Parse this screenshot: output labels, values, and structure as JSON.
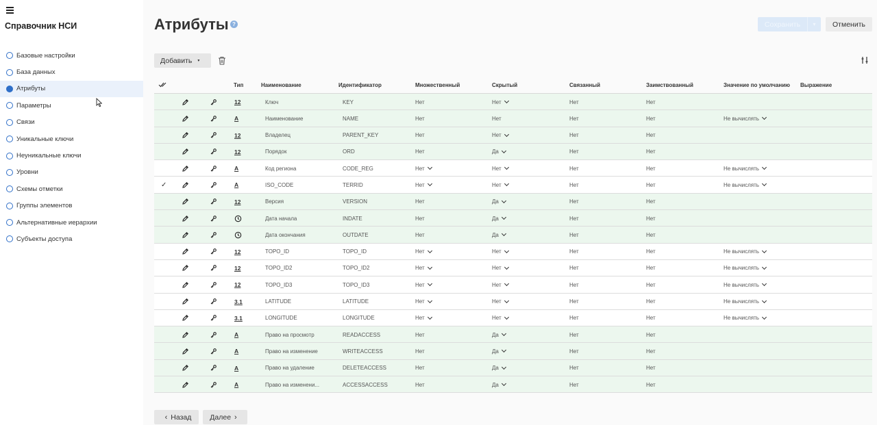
{
  "sidebar": {
    "title": "Справочник НСИ",
    "items": [
      {
        "label": "Базовые настройки",
        "active": false
      },
      {
        "label": "База данных",
        "active": false
      },
      {
        "label": "Атрибуты",
        "active": true
      },
      {
        "label": "Параметры",
        "active": false
      },
      {
        "label": "Связи",
        "active": false
      },
      {
        "label": "Уникальные ключи",
        "active": false
      },
      {
        "label": "Неуникальные ключи",
        "active": false
      },
      {
        "label": "Уровни",
        "active": false
      },
      {
        "label": "Схемы отметки",
        "active": false
      },
      {
        "label": "Группы элементов",
        "active": false
      },
      {
        "label": "Альтернативные иерархии",
        "active": false
      },
      {
        "label": "Субъекты доступа",
        "active": false
      }
    ]
  },
  "header": {
    "title": "Атрибуты",
    "help_icon": "?",
    "save_label": "Сохранить",
    "cancel_label": "Отменить"
  },
  "toolbar": {
    "add_label": "Добавить",
    "add_caret": "▾"
  },
  "table": {
    "columns": {
      "type": "Тип",
      "name": "Наименование",
      "identifier": "Идентификатор",
      "multiple": "Множественный",
      "hidden": "Скрытый",
      "linked": "Связанный",
      "borrowed": "Заимствованный",
      "default": "Значение по умолчанию",
      "expression": "Выражение"
    },
    "rows": [
      {
        "bg": "green",
        "check": "",
        "type": "12",
        "name": "Ключ",
        "id": "KEY",
        "mult": "Нет",
        "mult_dd": false,
        "hidden": "Нет",
        "hidden_dd": true,
        "linked": "Нет",
        "borrowed": "Нет",
        "default": "",
        "default_dd": false
      },
      {
        "bg": "green",
        "check": "",
        "type": "A",
        "name": "Наименование",
        "id": "NAME",
        "mult": "Нет",
        "mult_dd": false,
        "hidden": "Нет",
        "hidden_dd": false,
        "linked": "Нет",
        "borrowed": "Нет",
        "default": "Не вычислять",
        "default_dd": true
      },
      {
        "bg": "green",
        "check": "",
        "type": "12",
        "name": "Владелец",
        "id": "PARENT_KEY",
        "mult": "Нет",
        "mult_dd": false,
        "hidden": "Нет",
        "hidden_dd": true,
        "linked": "Нет",
        "borrowed": "Нет",
        "default": "",
        "default_dd": false
      },
      {
        "bg": "green",
        "check": "",
        "type": "12",
        "name": "Порядок",
        "id": "ORD",
        "mult": "Нет",
        "mult_dd": false,
        "hidden": "Да",
        "hidden_dd": true,
        "linked": "Нет",
        "borrowed": "Нет",
        "default": "",
        "default_dd": false
      },
      {
        "bg": "white",
        "check": "",
        "type": "A",
        "name": "Код региона",
        "id": "CODE_REG",
        "mult": "Нет",
        "mult_dd": true,
        "hidden": "Нет",
        "hidden_dd": true,
        "linked": "Нет",
        "borrowed": "Нет",
        "default": "Не вычислять",
        "default_dd": true
      },
      {
        "bg": "white",
        "check": "✓",
        "type": "A",
        "name": "ISO_CODE",
        "id": "TERRID",
        "mult": "Нет",
        "mult_dd": true,
        "hidden": "Нет",
        "hidden_dd": true,
        "linked": "Нет",
        "borrowed": "Нет",
        "default": "Не вычислять",
        "default_dd": true
      },
      {
        "bg": "green",
        "check": "",
        "type": "12",
        "name": "Версия",
        "id": "VERSION",
        "mult": "Нет",
        "mult_dd": false,
        "hidden": "Да",
        "hidden_dd": true,
        "linked": "Нет",
        "borrowed": "Нет",
        "default": "",
        "default_dd": false
      },
      {
        "bg": "green",
        "check": "",
        "type": "clock",
        "name": "Дата начала",
        "id": "INDATE",
        "mult": "Нет",
        "mult_dd": false,
        "hidden": "Да",
        "hidden_dd": true,
        "linked": "Нет",
        "borrowed": "Нет",
        "default": "",
        "default_dd": false
      },
      {
        "bg": "green",
        "check": "",
        "type": "clock",
        "name": "Дата окончания",
        "id": "OUTDATE",
        "mult": "Нет",
        "mult_dd": false,
        "hidden": "Да",
        "hidden_dd": true,
        "linked": "Нет",
        "borrowed": "Нет",
        "default": "",
        "default_dd": false
      },
      {
        "bg": "white",
        "check": "",
        "type": "12",
        "name": "TOPO_ID",
        "id": "TOPO_ID",
        "mult": "Нет",
        "mult_dd": true,
        "hidden": "Нет",
        "hidden_dd": true,
        "linked": "Нет",
        "borrowed": "Нет",
        "default": "Не вычислять",
        "default_dd": true
      },
      {
        "bg": "white",
        "check": "",
        "type": "12",
        "name": "TOPO_ID2",
        "id": "TOPO_ID2",
        "mult": "Нет",
        "mult_dd": true,
        "hidden": "Нет",
        "hidden_dd": true,
        "linked": "Нет",
        "borrowed": "Нет",
        "default": "Не вычислять",
        "default_dd": true
      },
      {
        "bg": "white",
        "check": "",
        "type": "12",
        "name": "TOPO_ID3",
        "id": "TOPO_ID3",
        "mult": "Нет",
        "mult_dd": true,
        "hidden": "Нет",
        "hidden_dd": true,
        "linked": "Нет",
        "borrowed": "Нет",
        "default": "Не вычислять",
        "default_dd": true
      },
      {
        "bg": "white",
        "check": "",
        "type": "3.1",
        "name": "LATITUDE",
        "id": "LATITUDE",
        "mult": "Нет",
        "mult_dd": true,
        "hidden": "Нет",
        "hidden_dd": true,
        "linked": "Нет",
        "borrowed": "Нет",
        "default": "Не вычислять",
        "default_dd": true
      },
      {
        "bg": "white",
        "check": "",
        "type": "3.1",
        "name": "LONGITUDE",
        "id": "LONGITUDE",
        "mult": "Нет",
        "mult_dd": true,
        "hidden": "Нет",
        "hidden_dd": true,
        "linked": "Нет",
        "borrowed": "Нет",
        "default": "Не вычислять",
        "default_dd": true
      },
      {
        "bg": "green",
        "check": "",
        "type": "A",
        "name": "Право на просмотр",
        "id": "READACCESS",
        "mult": "Нет",
        "mult_dd": false,
        "hidden": "Да",
        "hidden_dd": true,
        "linked": "Нет",
        "borrowed": "Нет",
        "default": "",
        "default_dd": false
      },
      {
        "bg": "green",
        "check": "",
        "type": "A",
        "name": "Право на изменение",
        "id": "WRITEACCESS",
        "mult": "Нет",
        "mult_dd": false,
        "hidden": "Да",
        "hidden_dd": true,
        "linked": "Нет",
        "borrowed": "Нет",
        "default": "",
        "default_dd": false
      },
      {
        "bg": "green",
        "check": "",
        "type": "A",
        "name": "Право на удаление",
        "id": "DELETEACCESS",
        "mult": "Нет",
        "mult_dd": false,
        "hidden": "Да",
        "hidden_dd": true,
        "linked": "Нет",
        "borrowed": "Нет",
        "default": "",
        "default_dd": false
      },
      {
        "bg": "green",
        "check": "",
        "type": "A",
        "name": "Право на изменени...",
        "id": "ACCESSACCESS",
        "mult": "Нет",
        "mult_dd": false,
        "hidden": "Да",
        "hidden_dd": true,
        "linked": "Нет",
        "borrowed": "Нет",
        "default": "",
        "default_dd": false
      }
    ]
  },
  "footer": {
    "back_label": "Назад",
    "next_label": "Далее"
  },
  "colors": {
    "accent": "#2f6fc8",
    "row_green": "#ecf7ee",
    "active_nav": "#eaf1fb"
  }
}
